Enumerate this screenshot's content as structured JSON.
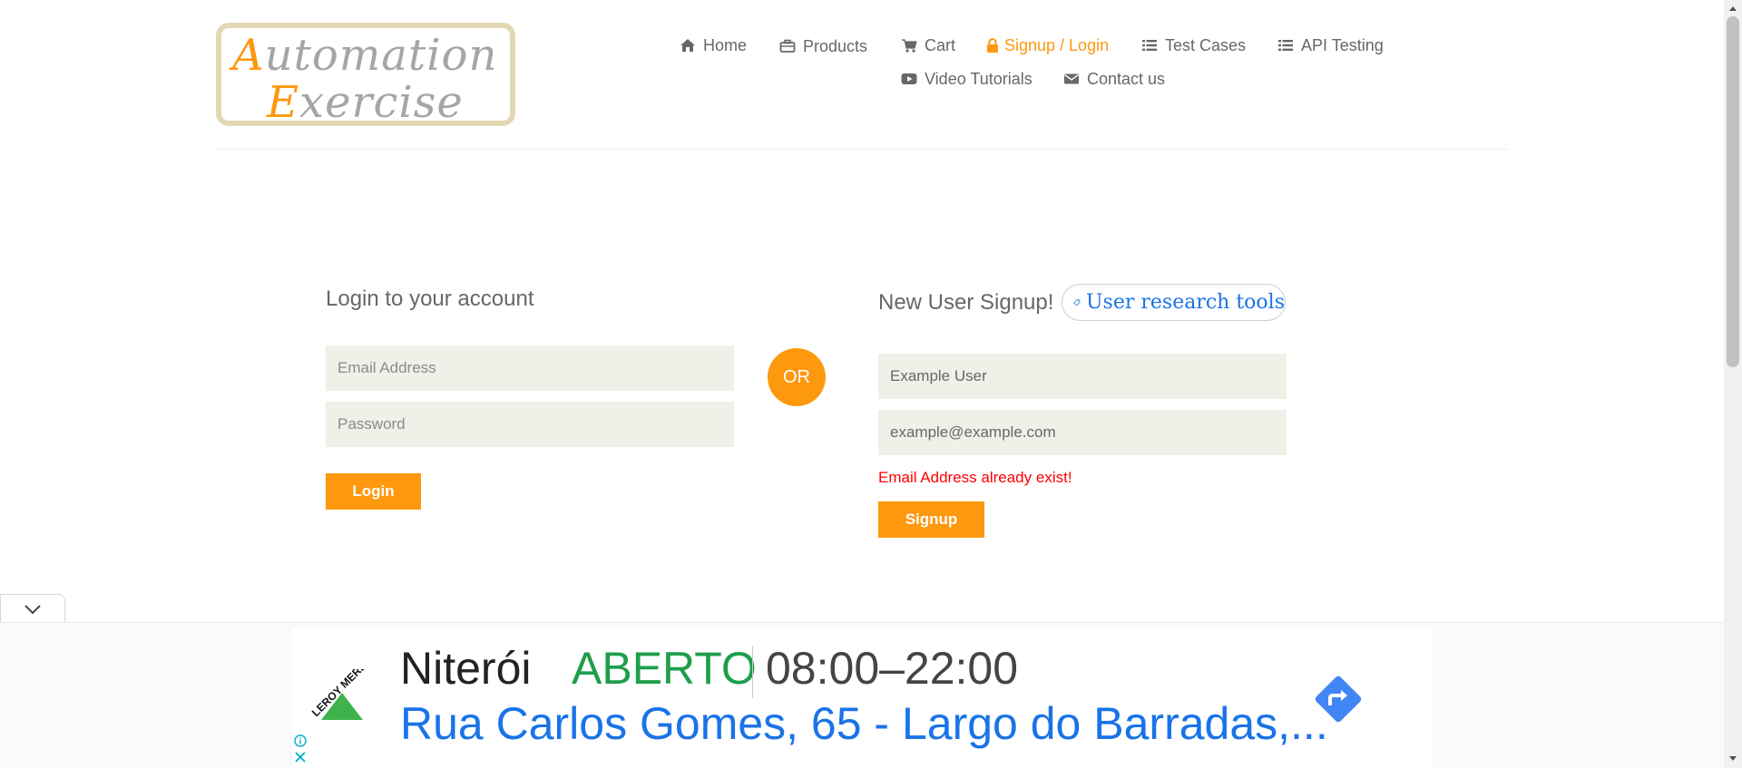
{
  "logo": {
    "line1_cap": "A",
    "line1_rest": "utomation",
    "line2_cap": "E",
    "line2_rest": "xercise"
  },
  "nav": {
    "items": [
      {
        "label": "Home",
        "icon": "home-icon"
      },
      {
        "label": "Products",
        "icon": "briefcase-icon"
      },
      {
        "label": "Cart",
        "icon": "cart-icon"
      },
      {
        "label": "Signup / Login",
        "icon": "lock-icon",
        "active": true
      },
      {
        "label": "Test Cases",
        "icon": "list-icon"
      },
      {
        "label": "API Testing",
        "icon": "list-icon"
      },
      {
        "label": "Video Tutorials",
        "icon": "youtube-play-icon"
      },
      {
        "label": "Contact us",
        "icon": "envelope-icon"
      }
    ]
  },
  "login": {
    "title": "Login to your account",
    "email_placeholder": "Email Address",
    "password_placeholder": "Password",
    "button": "Login"
  },
  "divider": {
    "label": "OR"
  },
  "signup": {
    "title": "New User Signup!",
    "name_value": "Example User",
    "email_value": "example@example.com",
    "error": "Email Address already exist!",
    "button": "Signup"
  },
  "research_chip": {
    "label": "User research tools",
    "icon": "tag-icon"
  },
  "ad": {
    "city": "Niterói",
    "status": "ABERTO",
    "hours": "08:00–22:00",
    "address": "Rua Carlos Gomes, 65 - Largo do Barradas,...",
    "brand": "LEROY MERLIN",
    "icons": [
      "info-icon",
      "close-icon",
      "directions-icon",
      "chevron-down-icon"
    ]
  },
  "colors": {
    "accent": "#fe980f",
    "text": "#696763",
    "field_bg": "#f0f0e9",
    "error": "#ff0000",
    "link_blue": "#1a73e8",
    "open_green": "#1e9e4a"
  }
}
